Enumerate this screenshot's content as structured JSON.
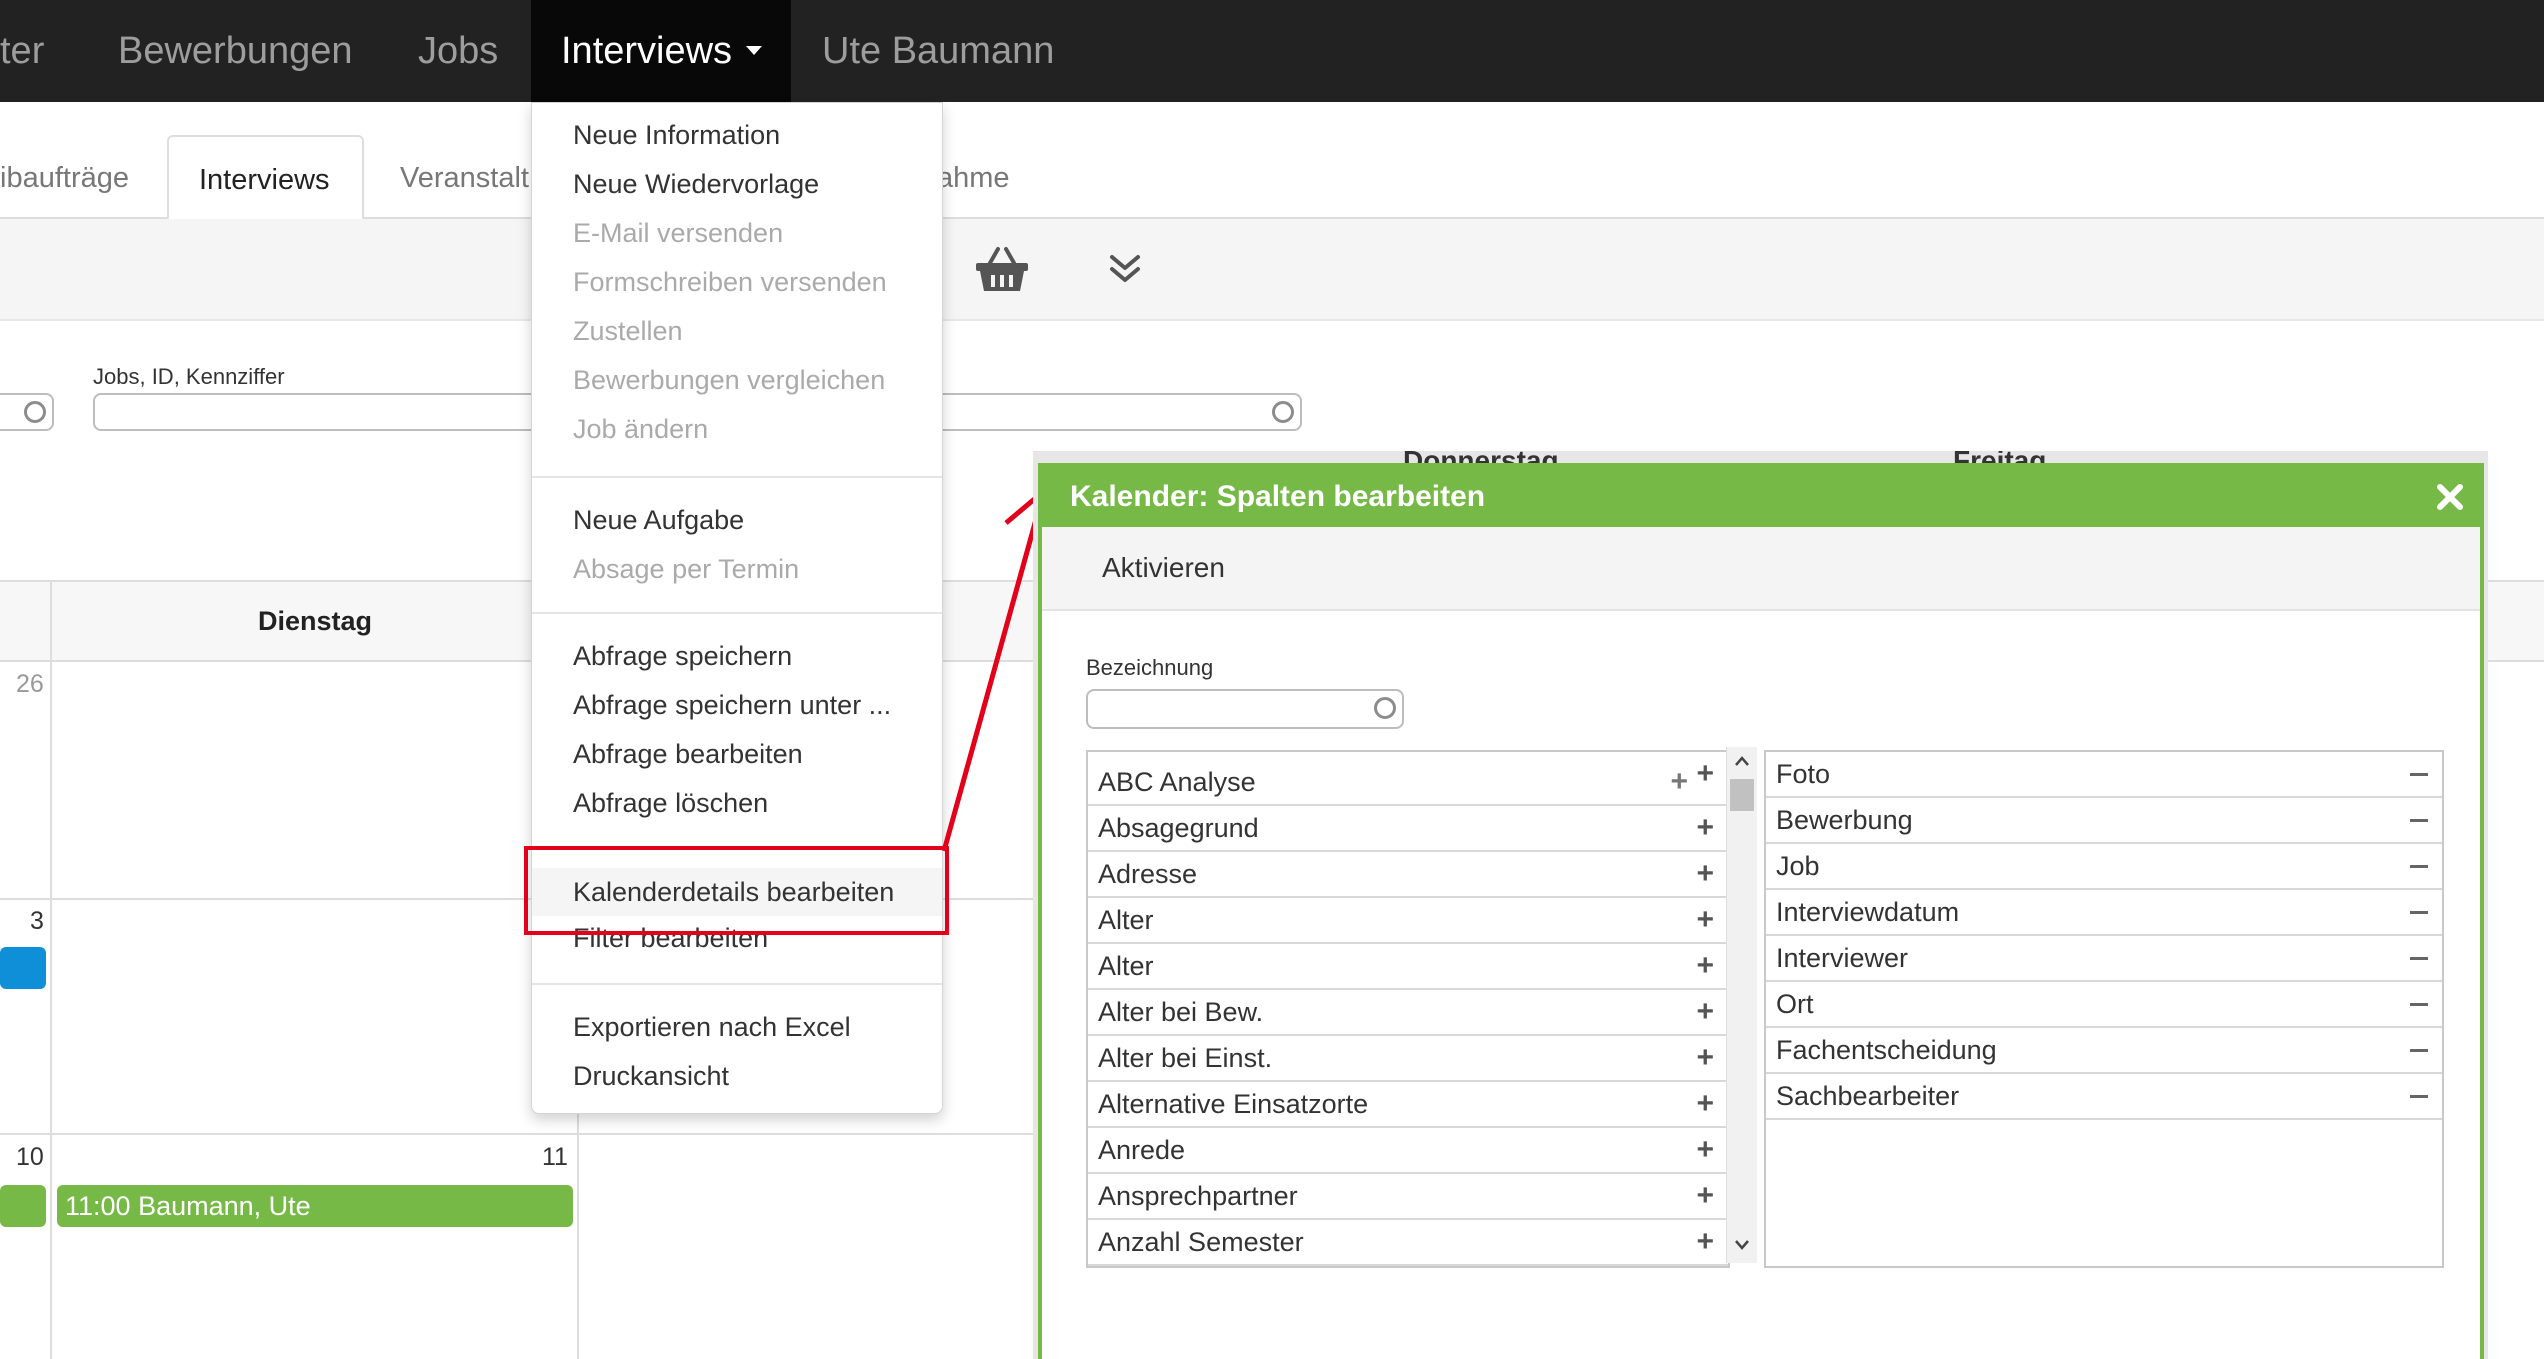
{
  "topnav": {
    "items": [
      "ter",
      "Bewerbungen",
      "Jobs",
      "Interviews",
      "Ute Baumann"
    ]
  },
  "tabs": {
    "items": [
      "ibaufträge",
      "Interviews",
      "Veranstalt",
      "ahme"
    ]
  },
  "filters": {
    "jobs_label": "Jobs, ID, Kennziffer"
  },
  "calendar": {
    "day_header": "Dienstag",
    "partial_headers": [
      "Donnerstag",
      "Freitag"
    ],
    "day_numbers": [
      "26",
      "3",
      "10",
      "11"
    ],
    "event_text": "11:00 Baumann, Ute"
  },
  "dropdown": {
    "group1": [
      "Neue Information",
      "Neue Wiedervorlage",
      "E-Mail versenden",
      "Formschreiben versenden",
      "Zustellen",
      "Bewerbungen vergleichen",
      "Job ändern"
    ],
    "group2": [
      "Neue Aufgabe",
      "Absage per Termin"
    ],
    "group3": [
      "Abfrage speichern",
      "Abfrage speichern unter ...",
      "Abfrage bearbeiten",
      "Abfrage löschen"
    ],
    "group4": [
      "Kalenderdetails bearbeiten",
      "Filter bearbeiten"
    ],
    "group5": [
      "Exportieren nach Excel",
      "Druckansicht"
    ]
  },
  "dialog": {
    "title": "Kalender: Spalten bearbeiten",
    "close_icon": "close-icon",
    "tab": "Aktivieren",
    "search_label": "Bezeichnung",
    "available": [
      "ABC Analyse",
      "Absagegrund",
      "Adresse",
      "Alter",
      "Alter",
      "Alter bei Bew.",
      "Alter bei Einst.",
      "Alternative Einsatzorte",
      "Anrede",
      "Ansprechpartner",
      "Anzahl Semester"
    ],
    "selected": [
      "Foto",
      "Bewerbung",
      "Job",
      "Interviewdatum",
      "Interviewer",
      "Ort",
      "Fachentscheidung",
      "Sachbearbeiter"
    ],
    "add_symbol": "+"
  },
  "colors": {
    "nav_bg": "#222222",
    "accent_green": "#76b947",
    "event_blue": "#0f8fd8",
    "annotation_red": "#e3001b"
  }
}
